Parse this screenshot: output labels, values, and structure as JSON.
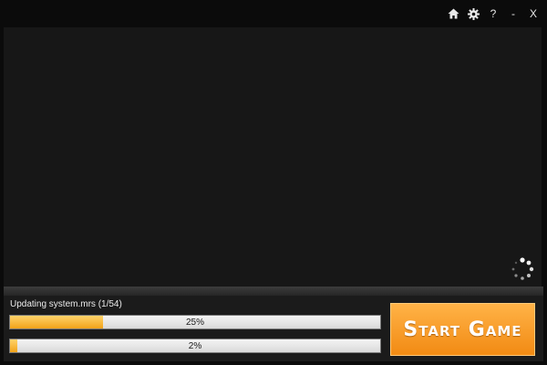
{
  "window_controls": {
    "home_icon": "home-icon",
    "settings_icon": "gear-icon",
    "help_label": "?",
    "minimize_label": "-",
    "close_label": "X"
  },
  "update": {
    "status": "Updating system.mrs (1/54)",
    "file_progress": {
      "value": 25,
      "label": "25%"
    },
    "total_progress": {
      "value": 2,
      "label": "2%"
    }
  },
  "actions": {
    "start_label": "Start Game"
  },
  "colors": {
    "accent": "#f28a13",
    "progress_fill": "#f2a319",
    "background": "#0b0b0b"
  }
}
